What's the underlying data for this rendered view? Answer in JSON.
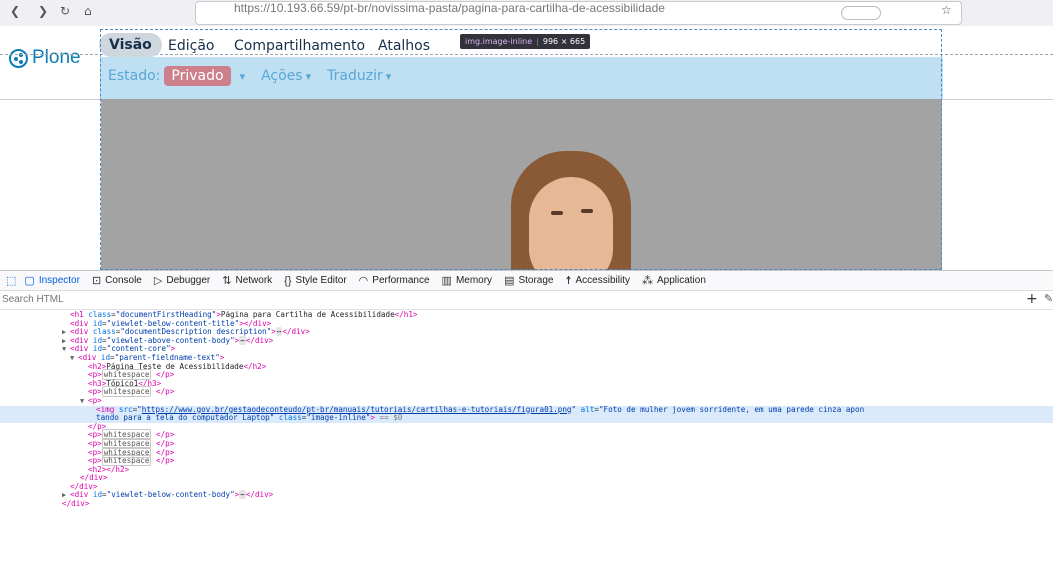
{
  "browser": {
    "url": "https://10.193.66.59/pt-br/novissima-pasta/pagina-para-cartilha-de-acessibilidade",
    "nav_back": "❮",
    "nav_forward": "❯",
    "reload": "↻",
    "home": "⌂",
    "bookmark": "☆"
  },
  "plone": {
    "logo_text": "Plone",
    "tabs": [
      "Visão",
      "Edição",
      "Compartilhamento",
      "Atalhos"
    ],
    "status_label": "Estado:",
    "state": "Privado",
    "actions": "Ações",
    "translate": "Traduzir",
    "caret": "▾",
    "tooltip": {
      "tag": "img.image-inline",
      "size": "996 × 665"
    },
    "image_alt": "Foto de mulher jovem sorridente, em uma parede cinza apontando para a tela do computador Laptop"
  },
  "devtools": {
    "tabs": [
      {
        "label": "Inspector",
        "icon": "inspector-icon",
        "glyph": "▢"
      },
      {
        "label": "Console",
        "icon": "console-icon",
        "glyph": "⊡"
      },
      {
        "label": "Debugger",
        "icon": "debugger-icon",
        "glyph": "▷"
      },
      {
        "label": "Network",
        "icon": "network-icon",
        "glyph": "⇅"
      },
      {
        "label": "Style Editor",
        "icon": "style-editor-icon",
        "glyph": "{}"
      },
      {
        "label": "Performance",
        "icon": "performance-icon",
        "glyph": "◠"
      },
      {
        "label": "Memory",
        "icon": "memory-icon",
        "glyph": "▥"
      },
      {
        "label": "Storage",
        "icon": "storage-icon",
        "glyph": "▤"
      },
      {
        "label": "Accessibility",
        "icon": "accessibility-icon",
        "glyph": "☨"
      },
      {
        "label": "Application",
        "icon": "application-icon",
        "glyph": "⁂"
      }
    ],
    "picker_glyph": "⬚",
    "search_placeholder": "Search HTML",
    "add_node": "+",
    "eyedropper": "✎",
    "markup": {
      "h1_class": "documentFirstHeading",
      "h1_text": "Página para Cartilha de Acessibilidade",
      "id_below_title": "viewlet-below-content-title",
      "desc_class": "documentDescription description",
      "id_above_body": "viewlet-above-content-body",
      "id_content_core": "content-core",
      "id_parent_field": "parent-fieldname-text",
      "h2_text": "Página Teste de Acessibilidade",
      "h3_text": "Tópico1",
      "whitespace": "whitespace",
      "img_src": "https://www.gov.br/gestaodeconteudo/pt-br/manuais/tutoriais/cartilhas-e-tutoriais/figura01.png",
      "img_alt_line1": "Foto de mulher jovem sorridente, em uma parede cinza apon",
      "img_alt_line2": "tando para a tela do computador Laptop",
      "img_class": "image-inline",
      "selected_marker": "== $0",
      "id_below_body": "viewlet-below-content-body",
      "ellipsis": "⋯"
    }
  }
}
